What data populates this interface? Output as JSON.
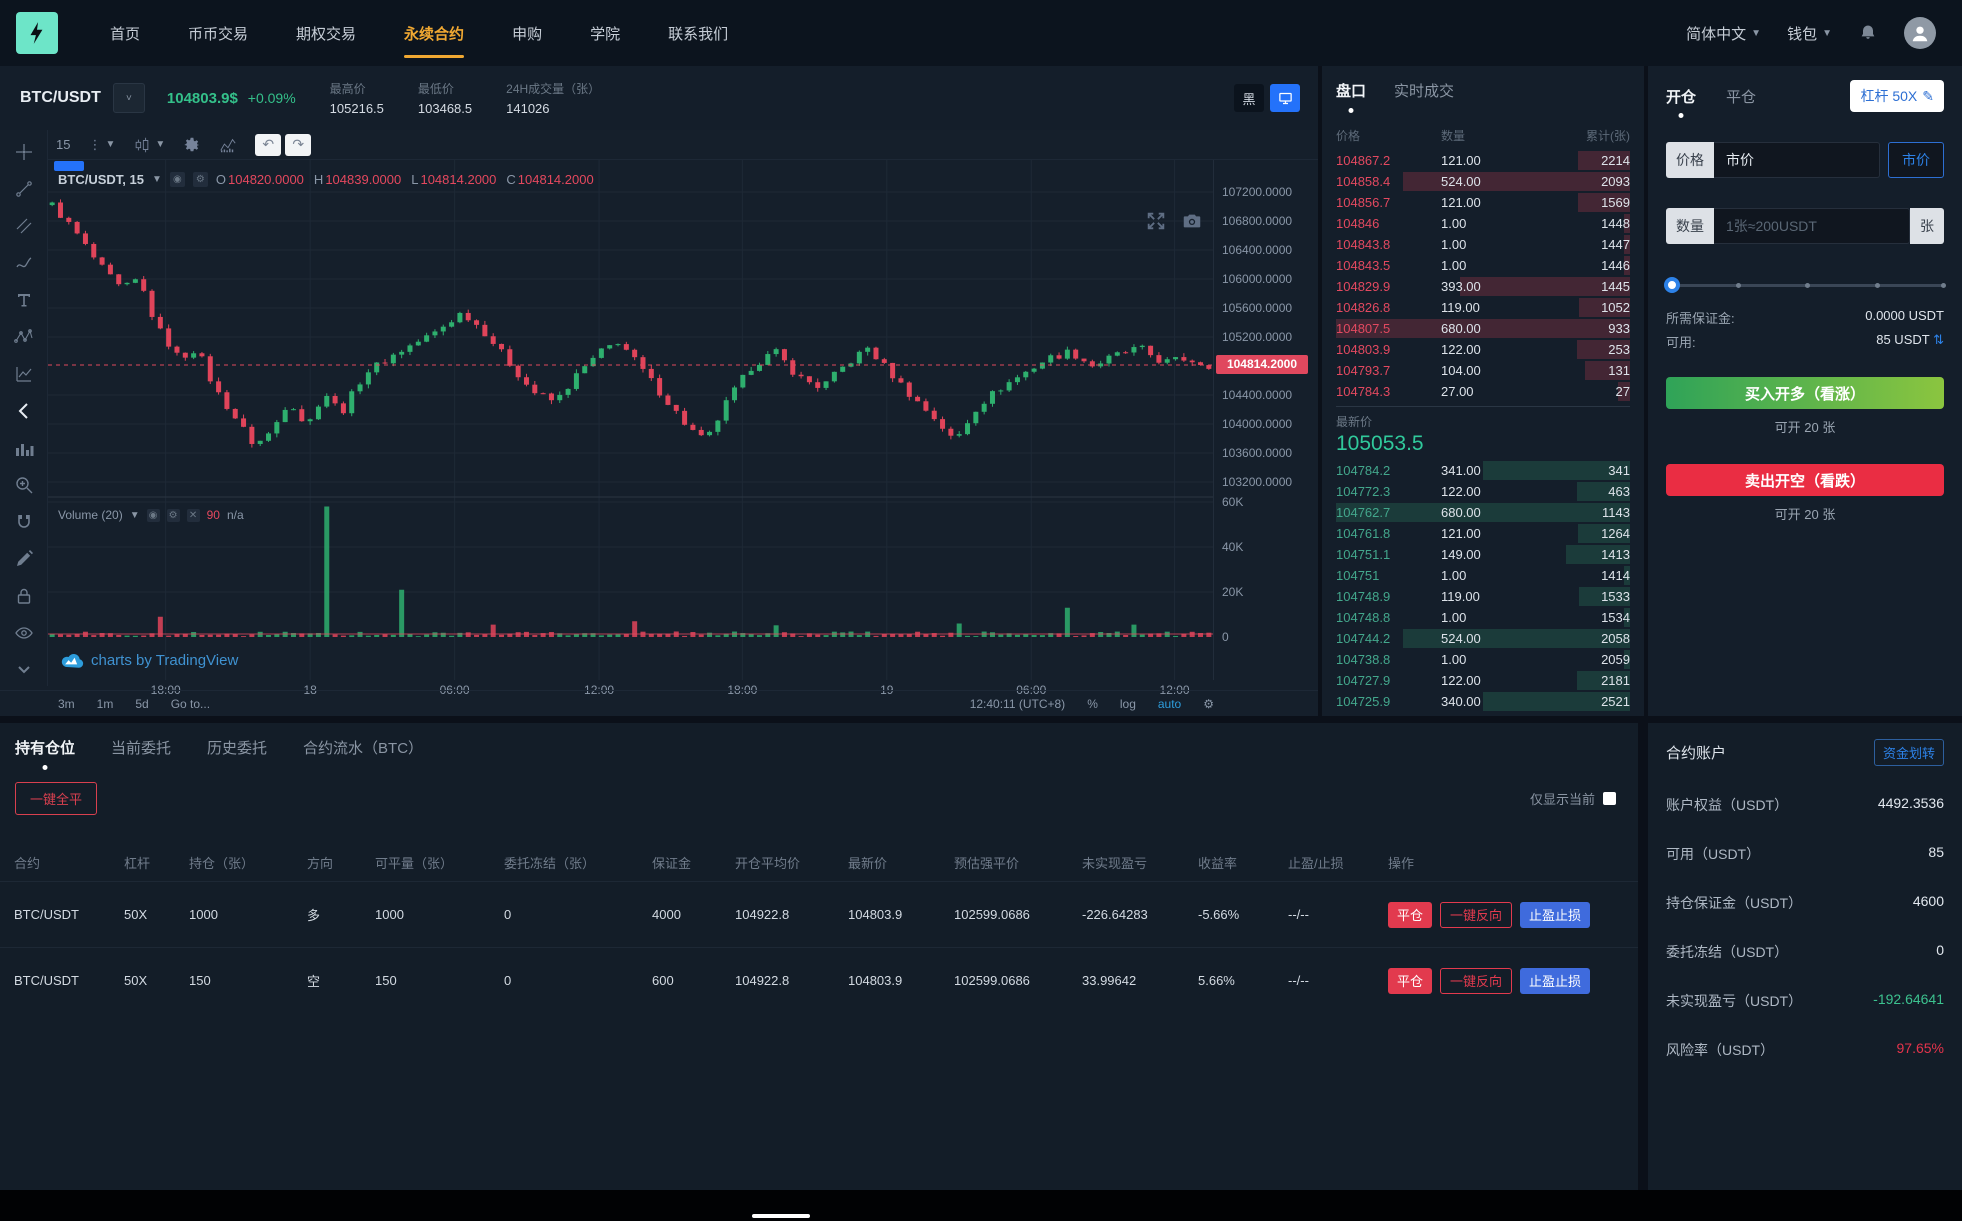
{
  "navbar": {
    "items": [
      "首页",
      "币币交易",
      "期权交易",
      "永续合约",
      "申购",
      "学院",
      "联系我们"
    ],
    "active_index": 3,
    "language": "简体中文",
    "wallet": "钱包"
  },
  "market_header": {
    "pair": "BTC/USDT",
    "price": "104803.9$",
    "change": "+0.09%",
    "stats": [
      {
        "label": "最高价",
        "value": "105216.5"
      },
      {
        "label": "最低价",
        "value": "103468.5"
      },
      {
        "label": "24H成交量（张）",
        "value": "141026"
      }
    ],
    "theme_dark_label": "黑"
  },
  "chart": {
    "interval": "15",
    "toolbar_left": [
      "crosshair",
      "trend-line",
      "parallel-channel",
      "brush",
      "text",
      "xabcd-pattern",
      "forecast",
      "arrow-back",
      "histogram",
      "zoom",
      "magnet",
      "edit",
      "lock",
      "eye",
      "chevron-down"
    ],
    "legend": {
      "symbol": "BTC/USDT, 15",
      "o_k": "O",
      "o": "104820.0000",
      "h_k": "H",
      "h": "104839.0000",
      "l_k": "L",
      "l": "104814.2000",
      "c_k": "C",
      "c": "104814.2000"
    },
    "volume_legend": {
      "label": "Volume (20)",
      "value": "90",
      "na": "n/a"
    },
    "watermark": "charts by TradingView",
    "price_tag": "104814.2000",
    "bottom_left": [
      "3m",
      "1m",
      "5d",
      "Go to..."
    ],
    "bottom_right": {
      "time": "12:40:11 (UTC+8)",
      "percent": "%",
      "log": "log",
      "auto": "auto"
    },
    "chart_data": {
      "type": "candlestick",
      "symbol": "BTC/USDT",
      "interval_minutes": 15,
      "y_ticks": [
        {
          "label": "107200.0000",
          "price": 107200
        },
        {
          "label": "106800.0000",
          "price": 106800
        },
        {
          "label": "106400.0000",
          "price": 106400
        },
        {
          "label": "106000.0000",
          "price": 106000
        },
        {
          "label": "105600.0000",
          "price": 105600
        },
        {
          "label": "105200.0000",
          "price": 105200
        },
        {
          "label": "104400.0000",
          "price": 104400
        },
        {
          "label": "104000.0000",
          "price": 104000
        },
        {
          "label": "103600.0000",
          "price": 103600
        },
        {
          "label": "103200.0000",
          "price": 103200
        }
      ],
      "vol_ticks": [
        {
          "label": "60K",
          "value": 60000
        },
        {
          "label": "40K",
          "value": 40000
        },
        {
          "label": "20K",
          "value": 20000
        },
        {
          "label": "0",
          "value": 0
        }
      ],
      "x_ticks": [
        {
          "label": "18:00",
          "f": 0.101
        },
        {
          "label": "18",
          "f": 0.225
        },
        {
          "label": "06:00",
          "f": 0.349
        },
        {
          "label": "12:00",
          "f": 0.473
        },
        {
          "label": "18:00",
          "f": 0.596
        },
        {
          "label": "19",
          "f": 0.72
        },
        {
          "label": "06:00",
          "f": 0.844
        },
        {
          "label": "12:00",
          "f": 0.967
        }
      ],
      "last_price": 104814.2,
      "price_anchors": [
        [
          0,
          107020
        ],
        [
          0.02,
          106650
        ],
        [
          0.04,
          106200
        ],
        [
          0.06,
          105850
        ],
        [
          0.075,
          106000
        ],
        [
          0.09,
          105350
        ],
        [
          0.11,
          104900
        ],
        [
          0.125,
          105050
        ],
        [
          0.14,
          104500
        ],
        [
          0.16,
          104050
        ],
        [
          0.175,
          103700
        ],
        [
          0.19,
          103900
        ],
        [
          0.205,
          104350
        ],
        [
          0.22,
          103950
        ],
        [
          0.235,
          104450
        ],
        [
          0.25,
          104150
        ],
        [
          0.27,
          104700
        ],
        [
          0.3,
          105000
        ],
        [
          0.33,
          105250
        ],
        [
          0.355,
          105550
        ],
        [
          0.375,
          105250
        ],
        [
          0.395,
          104850
        ],
        [
          0.415,
          104450
        ],
        [
          0.435,
          104300
        ],
        [
          0.455,
          104700
        ],
        [
          0.475,
          105000
        ],
        [
          0.49,
          105150
        ],
        [
          0.51,
          104750
        ],
        [
          0.53,
          104350
        ],
        [
          0.55,
          103950
        ],
        [
          0.565,
          103750
        ],
        [
          0.585,
          104350
        ],
        [
          0.605,
          104800
        ],
        [
          0.625,
          105000
        ],
        [
          0.645,
          104650
        ],
        [
          0.665,
          104500
        ],
        [
          0.685,
          104800
        ],
        [
          0.705,
          105050
        ],
        [
          0.725,
          104700
        ],
        [
          0.745,
          104350
        ],
        [
          0.765,
          104050
        ],
        [
          0.78,
          103750
        ],
        [
          0.8,
          104250
        ],
        [
          0.82,
          104500
        ],
        [
          0.84,
          104700
        ],
        [
          0.86,
          104900
        ],
        [
          0.88,
          105000
        ],
        [
          0.9,
          104800
        ],
        [
          0.92,
          104950
        ],
        [
          0.94,
          105050
        ],
        [
          0.96,
          104850
        ],
        [
          0.98,
          104900
        ],
        [
          1,
          104814
        ]
      ],
      "volume_spikes": [
        {
          "f": 0.09,
          "v": 9000
        },
        {
          "f": 0.235,
          "v": 58000
        },
        {
          "f": 0.3,
          "v": 21000
        },
        {
          "f": 0.375,
          "v": 5500
        },
        {
          "f": 0.5,
          "v": 7000
        },
        {
          "f": 0.62,
          "v": 5200
        },
        {
          "f": 0.78,
          "v": 6000
        },
        {
          "f": 0.87,
          "v": 13000
        },
        {
          "f": 0.93,
          "v": 5500
        }
      ]
    }
  },
  "orderbook": {
    "tabs": [
      "盘口",
      "实时成交"
    ],
    "columns": [
      "价格",
      "数量",
      "累计(张)"
    ],
    "asks": [
      [
        "104867.2",
        "121.00",
        "2214"
      ],
      [
        "104858.4",
        "524.00",
        "2093"
      ],
      [
        "104856.7",
        "121.00",
        "1569"
      ],
      [
        "104846",
        "1.00",
        "1448"
      ],
      [
        "104843.8",
        "1.00",
        "1447"
      ],
      [
        "104843.5",
        "1.00",
        "1446"
      ],
      [
        "104829.9",
        "393.00",
        "1445"
      ],
      [
        "104826.8",
        "119.00",
        "1052"
      ],
      [
        "104807.5",
        "680.00",
        "933"
      ],
      [
        "104803.9",
        "122.00",
        "253"
      ],
      [
        "104793.7",
        "104.00",
        "131"
      ],
      [
        "104784.3",
        "27.00",
        "27"
      ]
    ],
    "last_price_label": "最新价",
    "last_price": "105053.5",
    "bids": [
      [
        "104784.2",
        "341.00",
        "341"
      ],
      [
        "104772.3",
        "122.00",
        "463"
      ],
      [
        "104762.7",
        "680.00",
        "1143"
      ],
      [
        "104761.8",
        "121.00",
        "1264"
      ],
      [
        "104751.1",
        "149.00",
        "1413"
      ],
      [
        "104751",
        "1.00",
        "1414"
      ],
      [
        "104748.9",
        "119.00",
        "1533"
      ],
      [
        "104748.8",
        "1.00",
        "1534"
      ],
      [
        "104744.2",
        "524.00",
        "2058"
      ],
      [
        "104738.8",
        "1.00",
        "2059"
      ],
      [
        "104727.9",
        "122.00",
        "2181"
      ],
      [
        "104725.9",
        "340.00",
        "2521"
      ]
    ]
  },
  "trade_panel": {
    "tabs": [
      "开仓",
      "平仓"
    ],
    "leverage": "杠杆 50X",
    "price_label": "价格",
    "price_value": "市价",
    "market_btn": "市价",
    "amount_label": "数量",
    "amount_placeholder": "1张≈200USDT",
    "unit": "张",
    "margin_label": "所需保证金:",
    "margin_value": "0.0000 USDT",
    "available_label": "可用:",
    "available_value": "85 USDT",
    "buy_btn": "买入开多（看涨）",
    "buy_hint": "可开 20 张",
    "sell_btn": "卖出开空（看跌）",
    "sell_hint": "可开 20 张"
  },
  "positions": {
    "tabs": [
      "持有仓位",
      "当前委托",
      "历史委托",
      "合约流水（BTC）"
    ],
    "close_all_btn": "一键全平",
    "only_current": "仅显示当前",
    "columns": [
      "合约",
      "杠杆",
      "持仓（张）",
      "方向",
      "可平量（张）",
      "委托冻结（张）",
      "保证金",
      "开仓平均价",
      "最新价",
      "预估强平价",
      "未实现盈亏",
      "收益率",
      "止盈/止损",
      "操作"
    ],
    "actions": [
      "平仓",
      "一键反向",
      "止盈止损"
    ],
    "rows": [
      [
        "BTC/USDT",
        "50X",
        "1000",
        "多",
        "1000",
        "0",
        "4000",
        "104922.8",
        "104803.9",
        "102599.0686",
        "-226.64283",
        "-5.66%",
        "--/--"
      ],
      [
        "BTC/USDT",
        "50X",
        "150",
        "空",
        "150",
        "0",
        "600",
        "104922.8",
        "104803.9",
        "102599.0686",
        "33.99642",
        "5.66%",
        "--/--"
      ]
    ]
  },
  "account": {
    "title": "合约账户",
    "transfer_link": "资金划转",
    "rows": [
      {
        "label": "账户权益（USDT）",
        "value": "4492.3536",
        "tone": ""
      },
      {
        "label": "可用（USDT）",
        "value": "85",
        "tone": ""
      },
      {
        "label": "持仓保证金（USDT）",
        "value": "4600",
        "tone": ""
      },
      {
        "label": "委托冻结（USDT）",
        "value": "0",
        "tone": ""
      },
      {
        "label": "未实现盈亏（USDT）",
        "value": "-192.64641",
        "tone": "green"
      },
      {
        "label": "风险率（USDT）",
        "value": "97.65%",
        "tone": "red"
      }
    ]
  },
  "colors": {
    "accent_orange": "#f0a832",
    "green": "#30c99b",
    "red": "#e34960",
    "blue": "#2d82e8",
    "candle_up": "#2eaf6e",
    "candle_down": "#e0445a"
  }
}
